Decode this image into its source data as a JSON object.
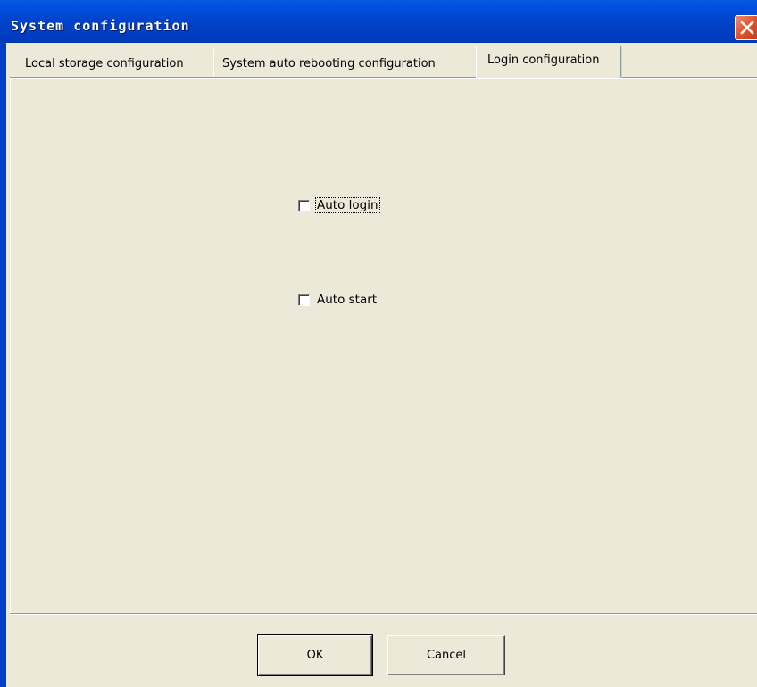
{
  "window": {
    "title": "System configuration"
  },
  "tabs": [
    {
      "label": "Local storage configuration",
      "selected": false
    },
    {
      "label": "System auto rebooting configuration",
      "selected": false
    },
    {
      "label": "Login configuration",
      "selected": true
    }
  ],
  "login_config": {
    "auto_login": {
      "label": "Auto login",
      "checked": false
    },
    "auto_start": {
      "label": "Auto start",
      "checked": false
    }
  },
  "buttons": {
    "ok_label": "OK",
    "cancel_label": "Cancel"
  },
  "colors": {
    "titlebar": "#0042c8",
    "dialog_bg": "#ece9d8",
    "close_button": "#e0512a"
  }
}
